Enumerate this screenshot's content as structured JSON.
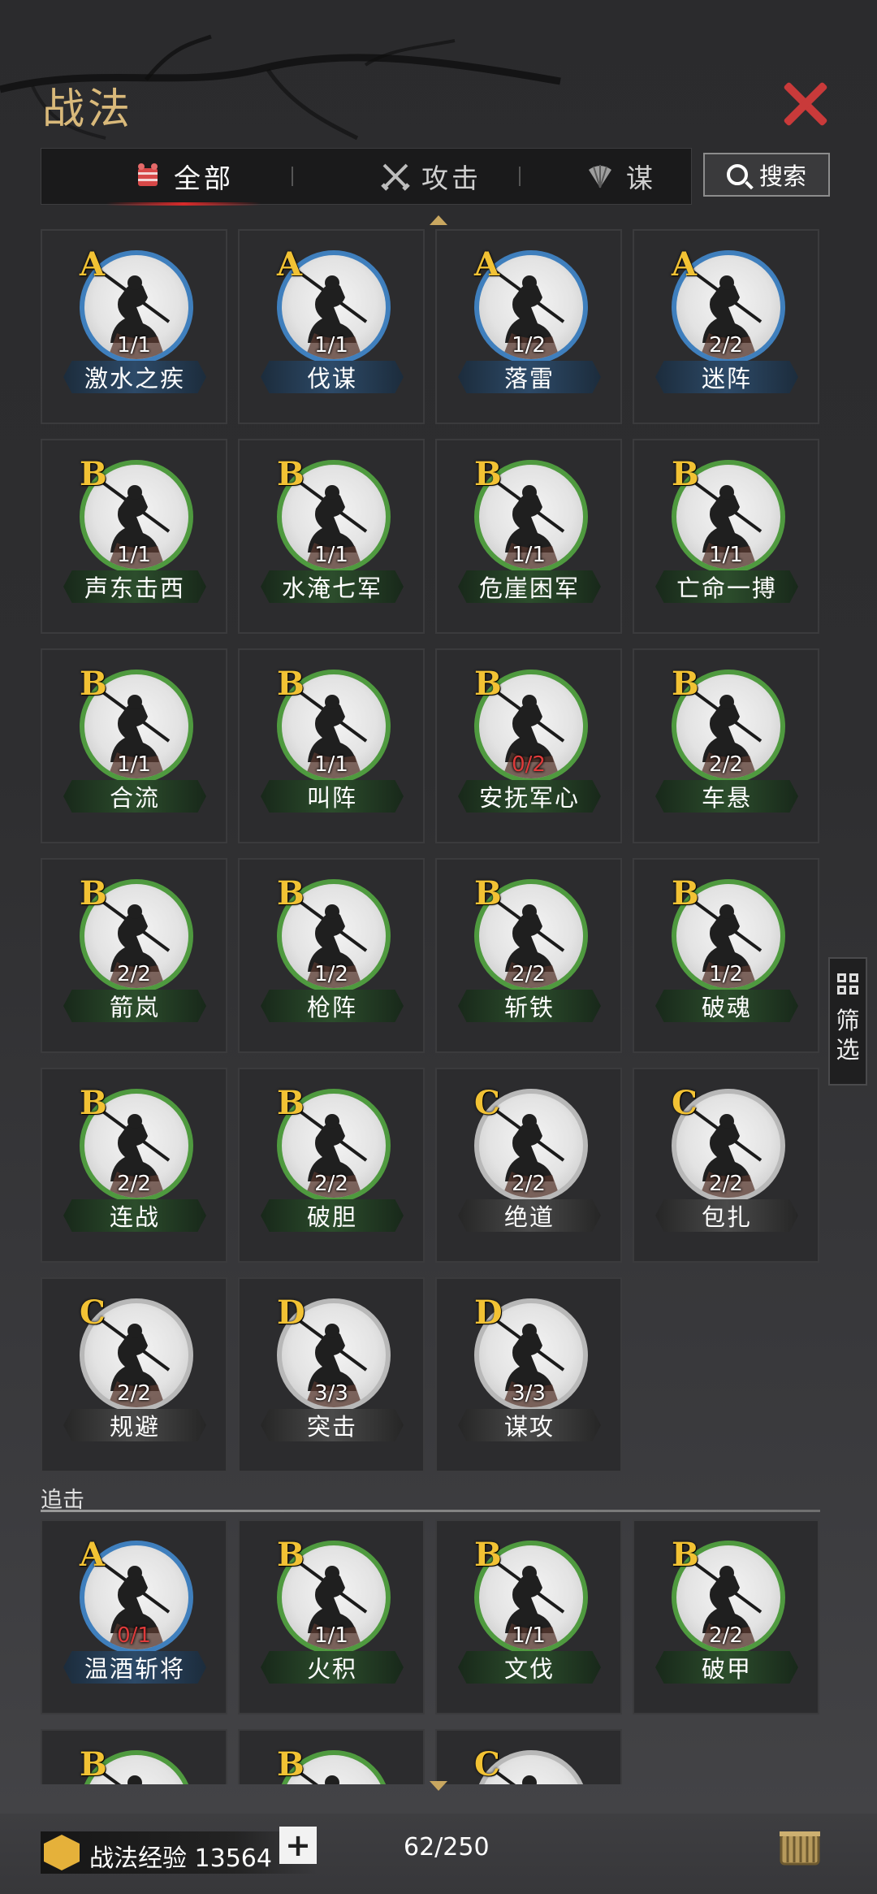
{
  "header": {
    "title": "战法"
  },
  "tabs": [
    {
      "label": "全部",
      "active": true,
      "icon": "scroll-bundle-icon"
    },
    {
      "label": "攻击",
      "active": false,
      "icon": "crossed-swords-icon"
    },
    {
      "label": "谋",
      "active": false,
      "icon": "fan-icon"
    }
  ],
  "search": {
    "label": "搜索"
  },
  "filter": {
    "label": "筛选"
  },
  "colors": {
    "accent_gold": "#d9b97a",
    "grade_yellow": "#f2c234",
    "close_red": "#c93a3a",
    "rarity_blue": "#3f7fbd",
    "rarity_green": "#4f9a3f",
    "rarity_gray": "#b8b8b8",
    "count_red": "#e03b3b"
  },
  "skills": [
    {
      "grade": "A",
      "count": "1/1",
      "name": "激水之疾",
      "tier": "blue"
    },
    {
      "grade": "A",
      "count": "1/1",
      "name": "伐谋",
      "tier": "blue"
    },
    {
      "grade": "A",
      "count": "1/2",
      "name": "落雷",
      "tier": "blue"
    },
    {
      "grade": "A",
      "count": "2/2",
      "name": "迷阵",
      "tier": "blue"
    },
    {
      "grade": "B",
      "count": "1/1",
      "name": "声东击西",
      "tier": "green"
    },
    {
      "grade": "B",
      "count": "1/1",
      "name": "水淹七军",
      "tier": "green"
    },
    {
      "grade": "B",
      "count": "1/1",
      "name": "危崖困军",
      "tier": "green"
    },
    {
      "grade": "B",
      "count": "1/1",
      "name": "亡命一搏",
      "tier": "green"
    },
    {
      "grade": "B",
      "count": "1/1",
      "name": "合流",
      "tier": "green"
    },
    {
      "grade": "B",
      "count": "1/1",
      "name": "叫阵",
      "tier": "green"
    },
    {
      "grade": "B",
      "count": "0/2",
      "name": "安抚军心",
      "tier": "green",
      "empty": true
    },
    {
      "grade": "B",
      "count": "2/2",
      "name": "车悬",
      "tier": "green"
    },
    {
      "grade": "B",
      "count": "2/2",
      "name": "箭岚",
      "tier": "green"
    },
    {
      "grade": "B",
      "count": "1/2",
      "name": "枪阵",
      "tier": "green"
    },
    {
      "grade": "B",
      "count": "2/2",
      "name": "斩铁",
      "tier": "green"
    },
    {
      "grade": "B",
      "count": "1/2",
      "name": "破魂",
      "tier": "green"
    },
    {
      "grade": "B",
      "count": "2/2",
      "name": "连战",
      "tier": "green"
    },
    {
      "grade": "B",
      "count": "2/2",
      "name": "破胆",
      "tier": "green"
    },
    {
      "grade": "C",
      "count": "2/2",
      "name": "绝道",
      "tier": "gray"
    },
    {
      "grade": "C",
      "count": "2/2",
      "name": "包扎",
      "tier": "gray"
    },
    {
      "grade": "C",
      "count": "2/2",
      "name": "规避",
      "tier": "gray"
    },
    {
      "grade": "D",
      "count": "3/3",
      "name": "突击",
      "tier": "gray"
    },
    {
      "grade": "D",
      "count": "3/3",
      "name": "谋攻",
      "tier": "gray"
    }
  ],
  "section_followup": {
    "label": "追击",
    "skills": [
      {
        "grade": "A",
        "count": "0/1",
        "name": "温酒斩将",
        "tier": "blue",
        "empty": true
      },
      {
        "grade": "B",
        "count": "1/1",
        "name": "火积",
        "tier": "green"
      },
      {
        "grade": "B",
        "count": "1/1",
        "name": "文伐",
        "tier": "green"
      },
      {
        "grade": "B",
        "count": "2/2",
        "name": "破甲",
        "tier": "green"
      },
      {
        "grade": "B",
        "count": "",
        "name": "",
        "tier": "green"
      },
      {
        "grade": "B",
        "count": "",
        "name": "",
        "tier": "green"
      },
      {
        "grade": "C",
        "count": "",
        "name": "",
        "tier": "gray"
      }
    ]
  },
  "footer": {
    "xp_label": "战法经验",
    "xp_value": "13564",
    "plus_label": "+",
    "capacity": "62/250"
  }
}
